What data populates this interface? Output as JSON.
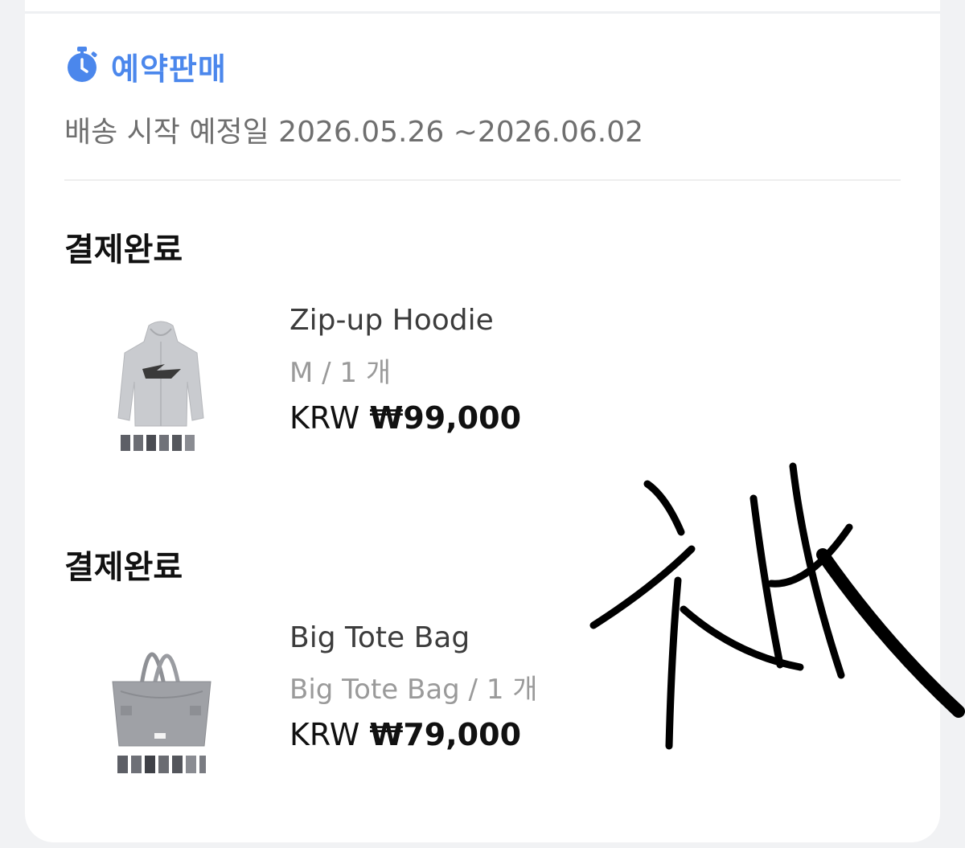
{
  "preorder": {
    "icon": "stopwatch-icon",
    "label": "예약판매",
    "color": "#4b87ec"
  },
  "shipping": {
    "text": "배송 시작 예정일 2026.05.26 ~2026.06.02"
  },
  "orders": [
    {
      "status": "결제완료",
      "name": "Zip-up Hoodie",
      "option": "M / 1 개",
      "currency": "KRW",
      "price": "₩99,000",
      "thumbnail": "hoodie-image"
    },
    {
      "status": "결제완료",
      "name": "Big Tote Bag",
      "option": "Big Tote Bag / 1 개",
      "currency": "KRW",
      "price": "₩79,000",
      "thumbnail": "tote-bag-image"
    }
  ]
}
